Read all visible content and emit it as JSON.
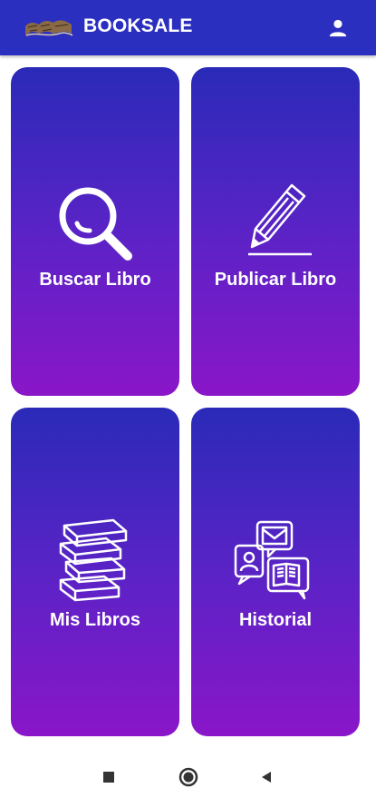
{
  "app_bar": {
    "title": "BOOKSALE",
    "logo_icon": "booksale-logo-icon",
    "profile_icon": "person-icon",
    "color": "#2b2fbf"
  },
  "cards": [
    {
      "label": "Buscar Libro",
      "icon": "magnifier-icon"
    },
    {
      "label": "Publicar Libro",
      "icon": "pencil-icon"
    },
    {
      "label": "Mis Libros",
      "icon": "book-stack-icon"
    },
    {
      "label": "Historial",
      "icon": "messages-icon"
    }
  ],
  "card_gradient": {
    "top": "#2a2ab8",
    "bottom": "#8a16c8"
  },
  "nav": {
    "recents_icon": "square-icon",
    "home_icon": "circle-icon",
    "back_icon": "triangle-back-icon"
  }
}
